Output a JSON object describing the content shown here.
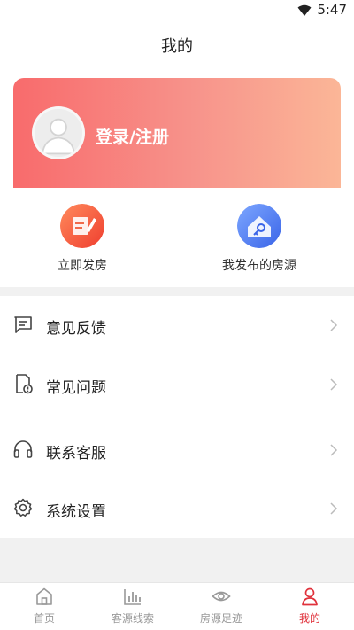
{
  "status_bar": {
    "time": "5:47",
    "wifi_icon": "wifi-icon"
  },
  "page": {
    "title": "我的"
  },
  "profile_card": {
    "avatar_icon": "avatar-placeholder-icon",
    "login_label": "登录/注册",
    "gradient_colors": [
      "#f86b6c",
      "#fbb697"
    ]
  },
  "quick_actions": [
    {
      "label": "立即发房",
      "icon": "post-listing-icon",
      "color": "#f3563a"
    },
    {
      "label": "我发布的房源",
      "icon": "my-listings-icon",
      "color": "#4f7df0"
    }
  ],
  "menu": [
    {
      "label": "意见反馈",
      "icon": "feedback-icon"
    },
    {
      "label": "常见问题",
      "icon": "faq-icon"
    },
    {
      "label": "联系客服",
      "icon": "headset-icon"
    },
    {
      "label": "系统设置",
      "icon": "settings-icon"
    }
  ],
  "tabbar": {
    "active_color": "#e0323c",
    "items": [
      {
        "label": "首页",
        "icon": "home-icon"
      },
      {
        "label": "客源线索",
        "icon": "leads-chart-icon"
      },
      {
        "label": "房源足迹",
        "icon": "eye-icon"
      },
      {
        "label": "我的",
        "icon": "profile-icon",
        "active": true
      }
    ]
  }
}
